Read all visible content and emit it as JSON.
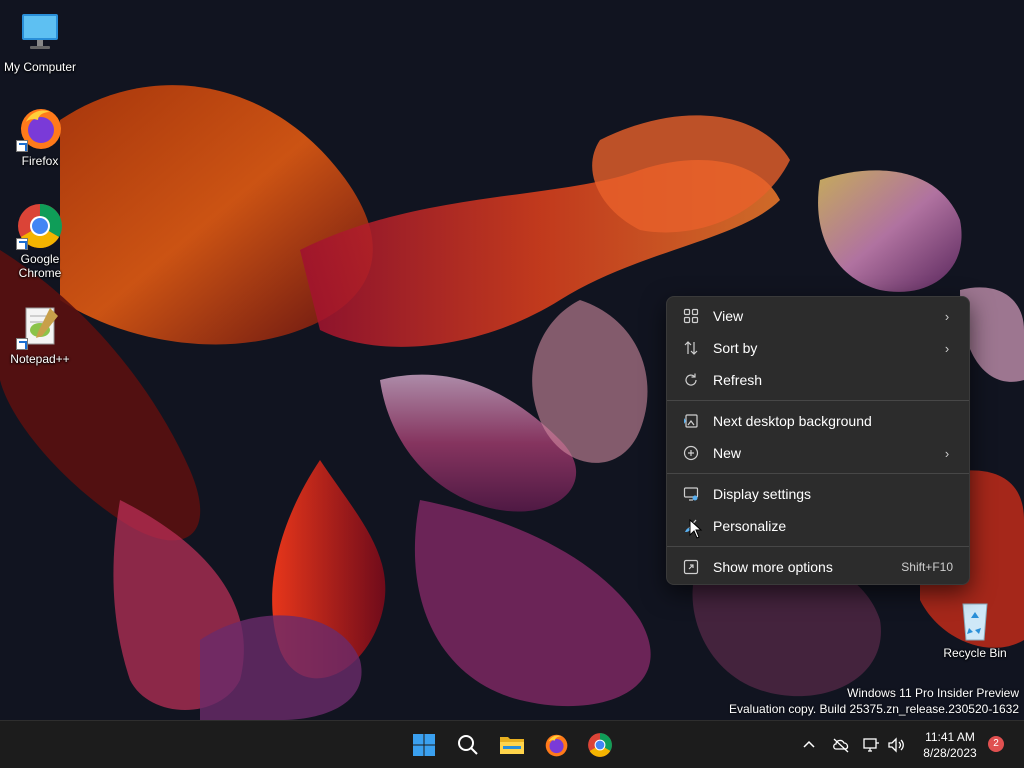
{
  "desktop": {
    "icons": [
      {
        "label": "My Computer",
        "icon": "monitor-icon"
      },
      {
        "label": "Firefox",
        "icon": "firefox-icon"
      },
      {
        "label": "Google Chrome",
        "icon": "chrome-icon"
      },
      {
        "label": "Notepad++",
        "icon": "notepadpp-icon"
      },
      {
        "label": "Recycle Bin",
        "icon": "recycle-bin-icon"
      }
    ]
  },
  "context_menu": {
    "items": [
      {
        "label": "View",
        "icon": "grid-icon",
        "has_submenu": true
      },
      {
        "label": "Sort by",
        "icon": "sort-icon",
        "has_submenu": true
      },
      {
        "label": "Refresh",
        "icon": "refresh-icon"
      },
      {
        "label": "Next desktop background",
        "icon": "next-background-icon"
      },
      {
        "label": "New",
        "icon": "plus-circle-icon",
        "has_submenu": true
      },
      {
        "label": "Display settings",
        "icon": "display-settings-icon"
      },
      {
        "label": "Personalize",
        "icon": "brush-icon"
      },
      {
        "label": "Show more options",
        "icon": "more-options-icon",
        "shortcut": "Shift+F10"
      }
    ]
  },
  "watermark": {
    "line1": "Windows 11 Pro Insider Preview",
    "line2": "Evaluation copy. Build 25375.zn_release.230520-1632"
  },
  "taskbar": {
    "apps": [
      "start-icon",
      "search-icon",
      "file-explorer-icon",
      "firefox-icon",
      "chrome-icon"
    ],
    "tray": [
      "chevron-up-icon",
      "cloud-off-icon",
      "network-icon",
      "speaker-icon"
    ],
    "time": "11:41 AM",
    "date": "8/28/2023",
    "notification_count": "2"
  },
  "colors": {
    "accent": "#0078d4",
    "menu_bg": "#2c2c2c",
    "taskbar_bg": "#1c1c1c"
  }
}
